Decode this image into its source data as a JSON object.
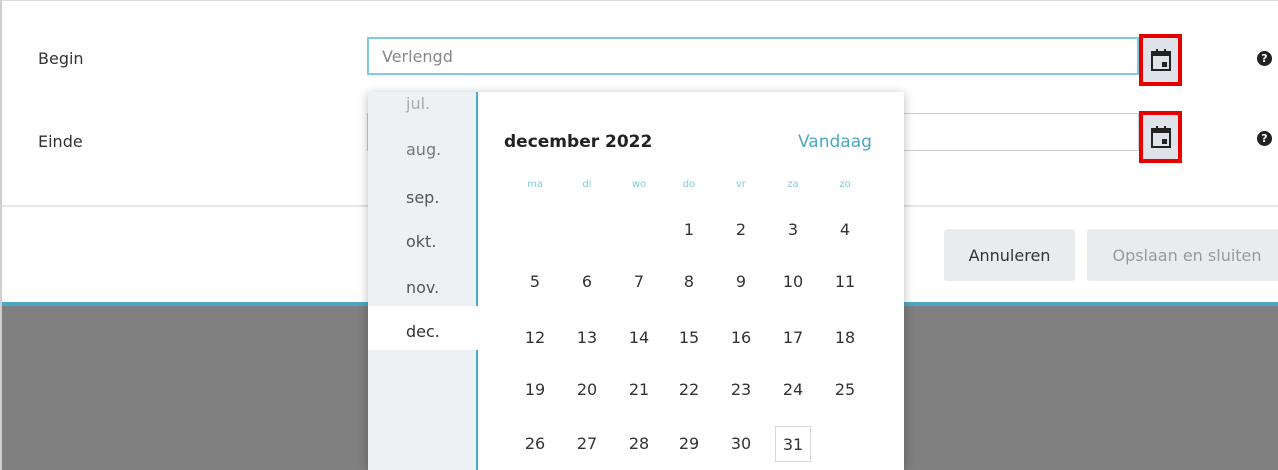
{
  "form": {
    "begin": {
      "label": "Begin",
      "value": "Verlengd"
    },
    "einde": {
      "label": "Einde",
      "value": ""
    }
  },
  "icons": {
    "calendar": "calendar-icon",
    "help": "question-circle-icon",
    "help_glyph": "?"
  },
  "buttons": {
    "cancel": "Annuleren",
    "save_close": "Opslaan en sluiten"
  },
  "datepicker": {
    "months": [
      "jul.",
      "aug.",
      "sep.",
      "okt.",
      "nov.",
      "dec."
    ],
    "selected_month": "dec.",
    "title": "december 2022",
    "today_label": "Vandaag",
    "weekdays": [
      "ma",
      "di",
      "wo",
      "do",
      "vr",
      "za",
      "zo"
    ],
    "weeks": [
      [
        "",
        "",
        "",
        "1",
        "2",
        "3",
        "4"
      ],
      [
        "5",
        "6",
        "7",
        "8",
        "9",
        "10",
        "11"
      ],
      [
        "12",
        "13",
        "14",
        "15",
        "16",
        "17",
        "18"
      ],
      [
        "19",
        "20",
        "21",
        "22",
        "23",
        "24",
        "25"
      ],
      [
        "26",
        "27",
        "28",
        "29",
        "30",
        "31",
        ""
      ]
    ],
    "highlighted_day": "31"
  },
  "colors": {
    "accent": "#4aa8c5",
    "highlight_border": "#e60000",
    "overlay": "#808080"
  }
}
